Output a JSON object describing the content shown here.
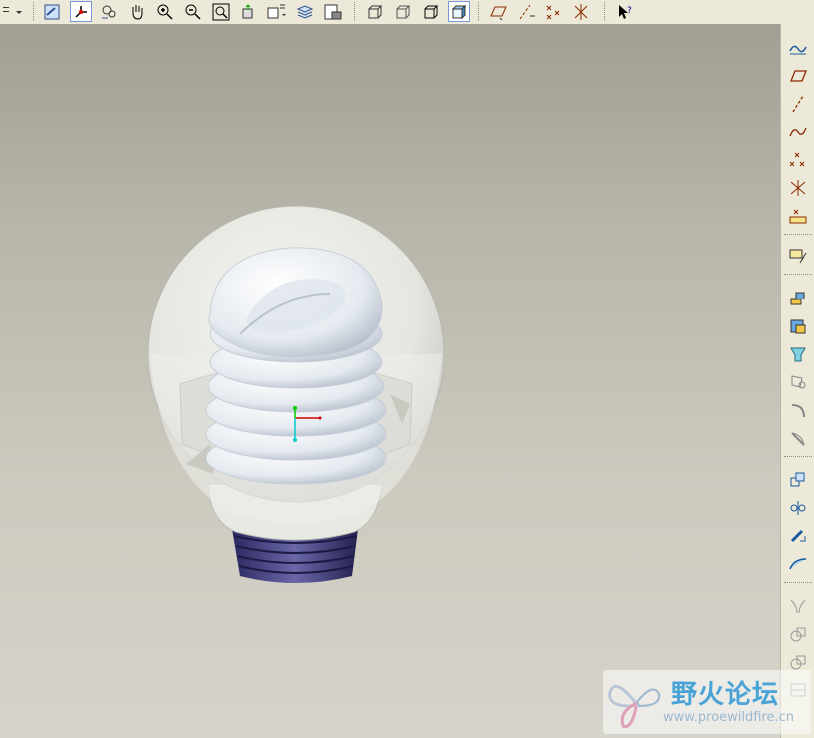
{
  "toolbar_top": {
    "buttons": [
      "dropdown-arrow",
      "repaint",
      "spin-center",
      "orient",
      "pan",
      "zoom-in",
      "zoom-out",
      "refit",
      "reorient",
      "saved-views",
      "layers",
      "model-setup",
      "wireframe",
      "hidden-line",
      "no-hidden",
      "shading",
      "datum-planes",
      "datum-axes",
      "datum-points",
      "coordinate-systems",
      "whats-this"
    ]
  },
  "toolbar_right": {
    "buttons": [
      "sketch",
      "plane",
      "axis",
      "curve",
      "datum-point",
      "coordinate-system",
      "analysis",
      "sketcher",
      "extrude",
      "revolve",
      "variable-section-sweep",
      "boundary-blend",
      "style",
      "draft",
      "round",
      "chamfer",
      "hole",
      "pattern",
      "mirror",
      "offset",
      "merge",
      "intersect",
      "trim",
      "thicken"
    ]
  },
  "viewport": {
    "model": "spiral-cfl-bulb",
    "axis_colors": {
      "x": "#cc0000",
      "y": "#00cc00",
      "z": "#00cccc"
    }
  },
  "watermark": {
    "title": "野火论坛",
    "url": "www.proewildfire.cn"
  }
}
